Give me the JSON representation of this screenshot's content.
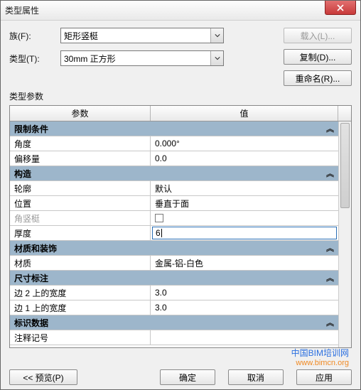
{
  "window": {
    "title": "类型属性"
  },
  "labels": {
    "family": "族(F):",
    "type": "类型(T):",
    "typeParams": "类型参数",
    "header_param": "参数",
    "header_value": "值"
  },
  "combos": {
    "family": "矩形竖梃",
    "type": "30mm 正方形"
  },
  "buttons": {
    "load": "载入(L)...",
    "duplicate": "复制(D)...",
    "rename": "重命名(R)...",
    "preview": "<< 预览(P)",
    "ok": "确定",
    "cancel": "取消",
    "apply": "应用"
  },
  "groups": {
    "constraints": "限制条件",
    "construction": "构造",
    "material": "材质和装饰",
    "dimensions": "尺寸标注",
    "identity": "标识数据"
  },
  "params": {
    "angle": {
      "label": "角度",
      "value": "0.000°"
    },
    "offset": {
      "label": "偏移量",
      "value": "0.0"
    },
    "profile": {
      "label": "轮廓",
      "value": "默认"
    },
    "position": {
      "label": "位置",
      "value": "垂直于面"
    },
    "cornerMullion": {
      "label": "角竖梃",
      "checked": false
    },
    "thickness": {
      "label": "厚度",
      "value": "6"
    },
    "materialParam": {
      "label": "材质",
      "value": "金属-铝-白色"
    },
    "width2": {
      "label": "边 2 上的宽度",
      "value": "3.0"
    },
    "width1": {
      "label": "边 1 上的宽度",
      "value": "3.0"
    },
    "keynote": {
      "label": "注释记号",
      "value": ""
    }
  },
  "watermark": {
    "line1": "中国BIM培训网",
    "line2": "www.bimcn.org"
  }
}
